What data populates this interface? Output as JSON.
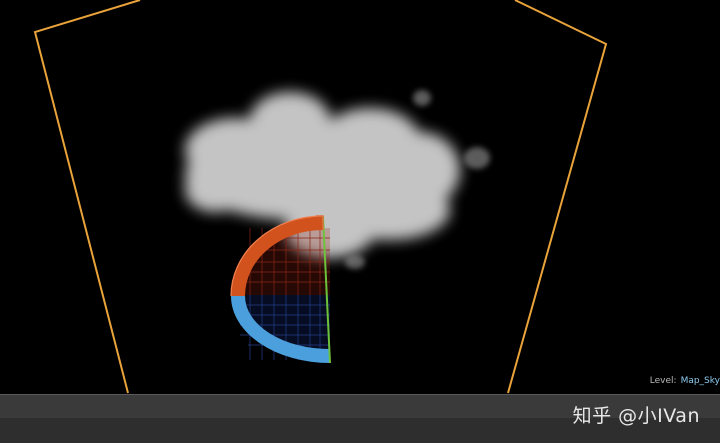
{
  "viewport": {
    "level_label": "Level:",
    "level_value": "Map_Sky"
  },
  "watermark": "知乎 @小IVan",
  "colors": {
    "background": "#000000",
    "frustum": "#e9a33a",
    "gizmo_red": "#d2521e",
    "gizmo_blue": "#4a9fdc",
    "gizmo_green": "#6cc23a",
    "cloud": "#d9d9d9",
    "bottom_bar": "#3a3a3a"
  }
}
